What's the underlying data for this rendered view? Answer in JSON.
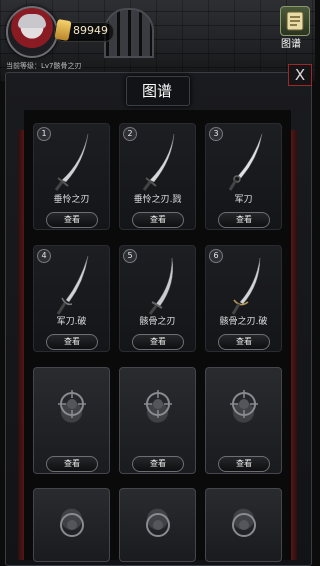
{
  "player": {
    "coins": "89949",
    "level_text": "当前等级：Lv7骸骨之刃"
  },
  "header": {
    "codex_label": "图谱"
  },
  "panel": {
    "title": "图谱",
    "close_label": "X",
    "view_label": "查看"
  },
  "items": [
    {
      "number": "1",
      "name": "垂怜之刃"
    },
    {
      "number": "2",
      "name": "垂怜之刃.戮"
    },
    {
      "number": "3",
      "name": "军刀"
    },
    {
      "number": "4",
      "name": "军刀.破"
    },
    {
      "number": "5",
      "name": "骸骨之刃"
    },
    {
      "number": "6",
      "name": "骸骨之刃.破"
    }
  ],
  "locked_items": [
    {
      "button": "查看"
    },
    {
      "button": "查看"
    },
    {
      "button": "查看"
    },
    {},
    {},
    {}
  ],
  "colors": {
    "accent_red": "#9a2a2a",
    "card_border": "#6d6e74",
    "coin": "#f5d36b"
  }
}
